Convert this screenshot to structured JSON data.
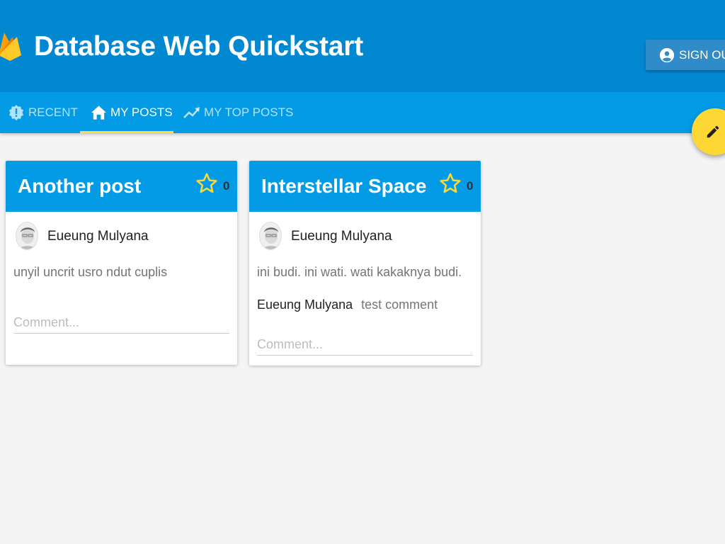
{
  "app": {
    "title": "Database Web Quickstart",
    "signout_label": "SIGN OUT"
  },
  "tabs": [
    {
      "label": "RECENT",
      "icon": "new-releases-icon",
      "active": false
    },
    {
      "label": "MY POSTS",
      "icon": "home-icon",
      "active": true
    },
    {
      "label": "MY TOP POSTS",
      "icon": "trending-up-icon",
      "active": false
    }
  ],
  "fab": {
    "icon": "pencil-icon"
  },
  "colors": {
    "appbar": "#0288d1",
    "tabbar": "#039be5",
    "accent": "#ffd740",
    "fab": "#fdd835",
    "background": "#f4f4f4"
  },
  "posts": [
    {
      "title": "Another post",
      "stars": "0",
      "author": "Eueung Mulyana",
      "body": "unyil uncrit usro ndut cuplis",
      "comments": [],
      "comment_placeholder": "Comment..."
    },
    {
      "title": "Interstellar Space",
      "stars": "0",
      "author": "Eueung Mulyana",
      "body": "ini budi. ini wati. wati kakaknya budi.",
      "comments": [
        {
          "author": "Eueung Mulyana",
          "text": "test comment"
        }
      ],
      "comment_placeholder": "Comment..."
    }
  ]
}
